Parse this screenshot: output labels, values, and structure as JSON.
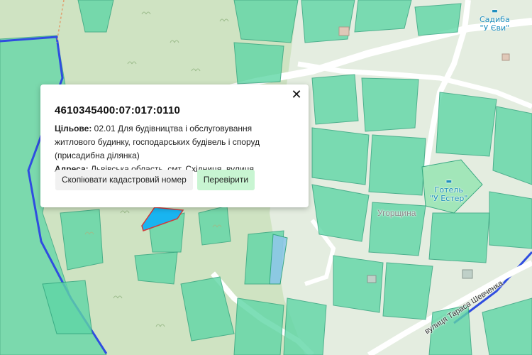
{
  "map": {
    "labels": {
      "sadyba_line1": "Садиба",
      "sadyba_line2": "\"У Єви\"",
      "hotel_line1": "Готель",
      "hotel_line2": "\"У Естер\"",
      "place_name": "Угорщина",
      "street_name": "вулиця Тараса Шевченка"
    },
    "colors": {
      "forest": "#cfe3c2",
      "parcel_fill": "#5fd6a6",
      "parcel_stroke": "#2aa27a",
      "road": "#ffffff",
      "boundary": "#2f4de0",
      "selected_parcel": "#19b4f0",
      "selected_outline": "#d13b3b"
    }
  },
  "popup": {
    "cadastral_number": "4610345400:07:017:0110",
    "purpose_label": "Цільове:",
    "purpose_value": "02.01 Для будівництва і обслуговування житлового будинку, господарських будівель і споруд (присадибна ділянка)",
    "address_label": "Адреса:",
    "address_value": "Львівська область, смт. Східниця, вулиця Шевченка, -",
    "copy_button": "Скопіювати кадастровий номер",
    "check_button": "Перевірити",
    "close_icon": "✕"
  }
}
